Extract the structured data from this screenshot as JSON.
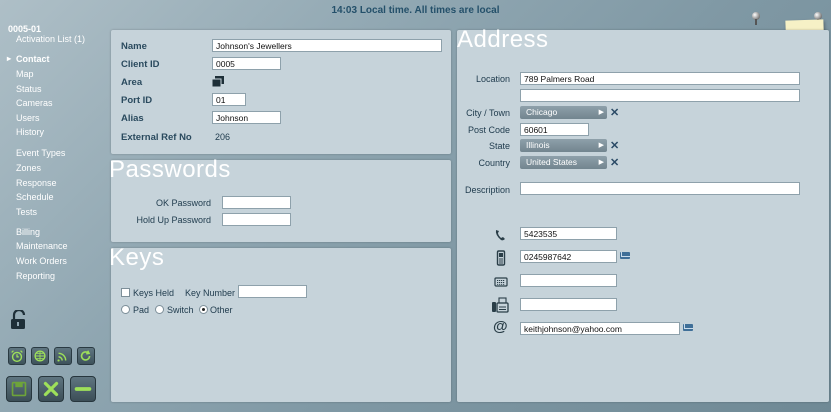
{
  "topbar": {
    "time": "14:03",
    "message": "Local time. All times are local"
  },
  "account_id": "0005-01",
  "nav": [
    {
      "label": "Activation List (1)",
      "active": false
    },
    {
      "label": "Contact",
      "active": true
    },
    {
      "label": "Map",
      "active": false
    },
    {
      "label": "Status",
      "active": false
    },
    {
      "label": "Cameras",
      "active": false
    },
    {
      "label": "Users",
      "active": false
    },
    {
      "label": "History",
      "active": false
    },
    {
      "label": "Event Types",
      "active": false
    },
    {
      "label": "Zones",
      "active": false
    },
    {
      "label": "Response",
      "active": false
    },
    {
      "label": "Schedule",
      "active": false
    },
    {
      "label": "Tests",
      "active": false
    },
    {
      "label": "Billing",
      "active": false
    },
    {
      "label": "Maintenance",
      "active": false
    },
    {
      "label": "Work Orders",
      "active": false
    },
    {
      "label": "Reporting",
      "active": false
    }
  ],
  "details": {
    "name_label": "Name",
    "name_value": "Johnson's Jewellers",
    "client_id_label": "Client ID",
    "client_id_value": "0005",
    "area_label": "Area",
    "port_id_label": "Port ID",
    "port_id_value": "01",
    "alias_label": "Alias",
    "alias_value": "Johnson",
    "external_ref_label": "External Ref No",
    "external_ref_value": "206"
  },
  "passwords": {
    "title": "Passwords",
    "ok_label": "OK Password",
    "ok_value": "",
    "holdup_label": "Hold Up Password",
    "holdup_value": ""
  },
  "keys": {
    "title": "Keys",
    "held_label": "Keys Held",
    "number_label": "Key Number",
    "number_value": "",
    "pad_label": "Pad",
    "switch_label": "Switch",
    "other_label": "Other"
  },
  "address": {
    "title": "Address",
    "location_label": "Location",
    "location_value": "789 Palmers Road",
    "location2_value": "",
    "city_label": "City / Town",
    "city_value": "Chicago",
    "postcode_label": "Post Code",
    "postcode_value": "60601",
    "state_label": "State",
    "state_value": "Illinois",
    "country_label": "Country",
    "country_value": "United States",
    "description_label": "Description",
    "description_value": "",
    "phone_value": "5423535",
    "mobile_value": "0245987642",
    "fax_value": "",
    "pager_value": "",
    "email_value": "keithjohnson@yahoo.com"
  },
  "colors": {
    "panel": "#c6d3da",
    "title": "#ffffff",
    "accent": "#2a4a5e",
    "select": "#7f929c"
  }
}
